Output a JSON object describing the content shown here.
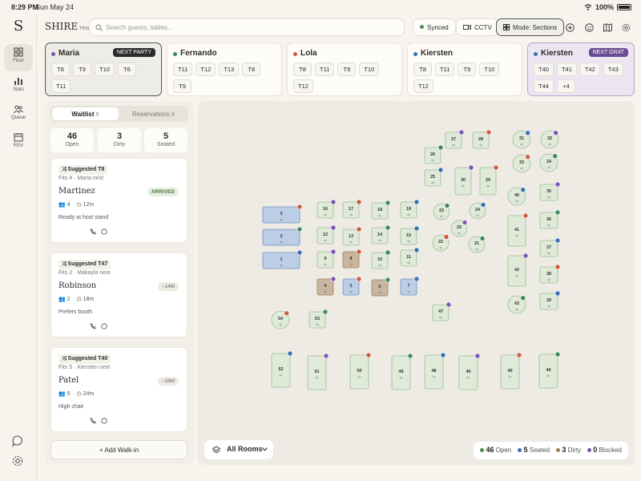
{
  "status": {
    "time": "8:29 PM",
    "date": "Sun May 24",
    "battery": "100%"
  },
  "rail": {
    "logo": "S",
    "items": [
      {
        "label": "Floor",
        "icon": "grid-icon",
        "active": true
      },
      {
        "label": "Stats",
        "icon": "bar-chart-icon",
        "active": false
      },
      {
        "label": "Queue",
        "icon": "people-icon",
        "active": false
      },
      {
        "label": "RSV",
        "icon": "calendar-icon",
        "active": false
      }
    ]
  },
  "topbar": {
    "brand": "SHIRE",
    "brand_sub": "Host",
    "search_placeholder": "Search guests, tables...",
    "synced": "Synced",
    "cctv": "CCTV",
    "mode": "Mode: Sections",
    "synced_color": "#4f8a4a"
  },
  "servers": [
    {
      "name": "Maria",
      "color": "#7b55b0",
      "badge": "NEXT PARTY",
      "tables": [
        "T8",
        "T9",
        "T10",
        "T6",
        "T11"
      ],
      "style": "sel"
    },
    {
      "name": "Fernando",
      "color": "#3e8a5a",
      "badge": "",
      "tables": [
        "T11",
        "T12",
        "T13",
        "T8",
        "T9"
      ],
      "style": ""
    },
    {
      "name": "Lola",
      "color": "#d05a3c",
      "badge": "",
      "tables": [
        "T8",
        "T11",
        "T9",
        "T10",
        "T12"
      ],
      "style": ""
    },
    {
      "name": "Kiersten",
      "color": "#3b6fb3",
      "badge": "",
      "tables": [
        "T8",
        "T11",
        "T9",
        "T10",
        "T12"
      ],
      "style": ""
    },
    {
      "name": "Kiersten",
      "color": "#3b6fb3",
      "badge": "NEXT GRAT",
      "tables": [
        "T40",
        "T41",
        "T42",
        "T43",
        "T44",
        "+4"
      ],
      "style": "purple"
    }
  ],
  "panel": {
    "tabs": [
      {
        "label": "Waitlist",
        "count": "5"
      },
      {
        "label": "Reservations",
        "count": "8"
      }
    ],
    "stats": [
      {
        "value": "46",
        "label": "Open"
      },
      {
        "value": "3",
        "label": "Dirty"
      },
      {
        "value": "5",
        "label": "Seated"
      }
    ],
    "guests": [
      {
        "suggest": "Suggested T8",
        "fits": "Fits 4 · Maria next",
        "name": "Martinez",
        "status": "ARRIVED",
        "party": "4",
        "wait": "12m",
        "note": "Ready at host stand"
      },
      {
        "suggest": "Suggested T47",
        "fits": "Fits 2 · Makayla next",
        "name": "Robinson",
        "status": "~14M",
        "party": "2",
        "wait": "18m",
        "note": "Prefers booth"
      },
      {
        "suggest": "Suggested T40",
        "fits": "Fits 5 · Kiersten next",
        "name": "Patel",
        "status": "~18M",
        "party": "5",
        "wait": "24m",
        "note": "High chair"
      }
    ],
    "add_walkin": "Add Walk-in"
  },
  "floor": {
    "rooms_label": "All Rooms",
    "legend": [
      {
        "value": "46",
        "label": "Open",
        "color": "#4f8a4a"
      },
      {
        "value": "5",
        "label": "Seated",
        "color": "#3b6fb3"
      },
      {
        "value": "3",
        "label": "Dirty",
        "color": "#9a7f5f"
      },
      {
        "value": "0",
        "label": "Blocked",
        "color": "#7b55b0"
      }
    ],
    "tables": [
      {
        "n": "3",
        "s": "blue"
      },
      {
        "n": "2",
        "s": "blue"
      },
      {
        "n": "1",
        "s": "blue"
      },
      {
        "n": "16",
        "s": "open"
      },
      {
        "n": "17",
        "s": "open"
      },
      {
        "n": "18",
        "s": "open"
      },
      {
        "n": "19",
        "s": "open"
      },
      {
        "n": "12",
        "s": "open"
      },
      {
        "n": "13",
        "s": "open"
      },
      {
        "n": "14",
        "s": "open"
      },
      {
        "n": "15",
        "s": "open"
      },
      {
        "n": "9",
        "s": "open"
      },
      {
        "n": "8",
        "s": "dirty"
      },
      {
        "n": "10",
        "s": "open"
      },
      {
        "n": "11",
        "s": "open"
      },
      {
        "n": "4",
        "s": "dirty"
      },
      {
        "n": "5",
        "s": "blue"
      },
      {
        "n": "6",
        "s": "dirty"
      },
      {
        "n": "7",
        "s": "blue"
      },
      {
        "n": "27",
        "s": "open"
      },
      {
        "n": "28",
        "s": "open"
      },
      {
        "n": "26",
        "s": "open"
      },
      {
        "n": "25",
        "s": "open"
      },
      {
        "n": "30",
        "s": "open"
      },
      {
        "n": "29",
        "s": "open"
      },
      {
        "n": "23",
        "s": "open"
      },
      {
        "n": "24",
        "s": "open"
      },
      {
        "n": "20",
        "s": "open"
      },
      {
        "n": "22",
        "s": "open"
      },
      {
        "n": "21",
        "s": "open"
      },
      {
        "n": "31",
        "s": "open"
      },
      {
        "n": "32",
        "s": "open"
      },
      {
        "n": "33",
        "s": "open"
      },
      {
        "n": "34",
        "s": "open"
      },
      {
        "n": "40",
        "s": "open"
      },
      {
        "n": "35",
        "s": "open"
      },
      {
        "n": "41",
        "s": "open"
      },
      {
        "n": "36",
        "s": "open"
      },
      {
        "n": "37",
        "s": "open"
      },
      {
        "n": "42",
        "s": "open"
      },
      {
        "n": "38",
        "s": "open"
      },
      {
        "n": "43",
        "s": "open"
      },
      {
        "n": "39",
        "s": "open"
      },
      {
        "n": "47",
        "s": "open"
      },
      {
        "n": "54",
        "s": "open"
      },
      {
        "n": "53",
        "s": "open"
      },
      {
        "n": "52",
        "s": "open"
      },
      {
        "n": "51",
        "s": "open"
      },
      {
        "n": "50",
        "s": "open"
      },
      {
        "n": "49",
        "s": "open"
      },
      {
        "n": "48",
        "s": "open"
      },
      {
        "n": "46",
        "s": "open"
      },
      {
        "n": "45",
        "s": "open"
      },
      {
        "n": "44",
        "s": "open"
      }
    ],
    "seat_label": "4p"
  }
}
